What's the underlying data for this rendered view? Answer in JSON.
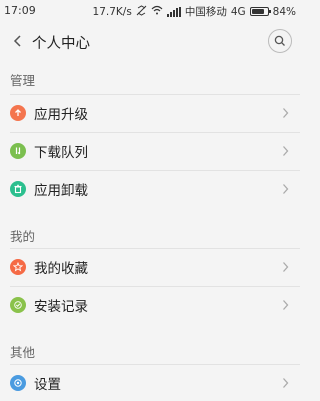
{
  "status_bar": {
    "time": "17:09",
    "net_speed": "17.7K/s",
    "carrier": "中国移动",
    "network": "4G",
    "battery": "84%",
    "battery_level": 0.84
  },
  "header": {
    "title": "个人中心"
  },
  "sections": [
    {
      "title": "管理",
      "items": [
        {
          "label": "应用升级",
          "icon": "upgrade-arrow-icon",
          "color": "#f4754e"
        },
        {
          "label": "下载队列",
          "icon": "download-queue-icon",
          "color": "#7bbf4f"
        },
        {
          "label": "应用卸载",
          "icon": "uninstall-trash-icon",
          "color": "#2bbf8e"
        }
      ]
    },
    {
      "title": "我的",
      "items": [
        {
          "label": "我的收藏",
          "icon": "star-icon",
          "color": "#f56a45"
        },
        {
          "label": "安装记录",
          "icon": "check-icon",
          "color": "#8ac24b"
        }
      ]
    },
    {
      "title": "其他",
      "items": [
        {
          "label": "设置",
          "icon": "settings-icon",
          "color": "#4a9be0"
        }
      ]
    }
  ]
}
